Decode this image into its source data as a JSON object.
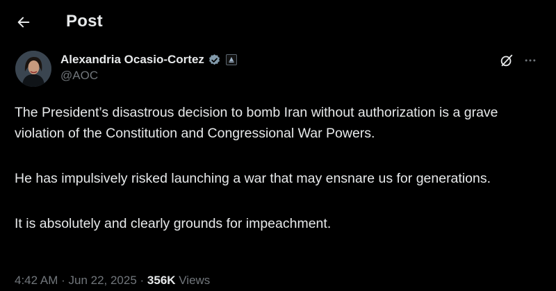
{
  "header": {
    "title": "Post",
    "back_icon": "arrow-left-icon"
  },
  "author": {
    "name": "Alexandria Ocasio-Cortez",
    "handle": "@AOC",
    "verified_icon": "verified-badge-icon",
    "verified_color": "#829aab",
    "affiliate_icon": "government-affiliate-icon"
  },
  "actions": {
    "grok_icon": "grok-icon",
    "more_icon": "more-options-icon"
  },
  "tweet": {
    "paragraphs": [
      "The President’s disastrous decision to bomb Iran without authorization is a grave violation of the Constitution and Congressional War Powers.",
      "He has impulsively risked launching a war that may ensnare us for generations.",
      "It is absolutely and clearly grounds for impeachment."
    ]
  },
  "meta": {
    "time": "4:42 AM",
    "separator": " · ",
    "date": "Jun 22, 2025",
    "views_count": "356K",
    "views_label": " Views"
  },
  "colors": {
    "background": "#000000",
    "text_primary": "#e7e9ea",
    "text_secondary": "#71767b"
  }
}
